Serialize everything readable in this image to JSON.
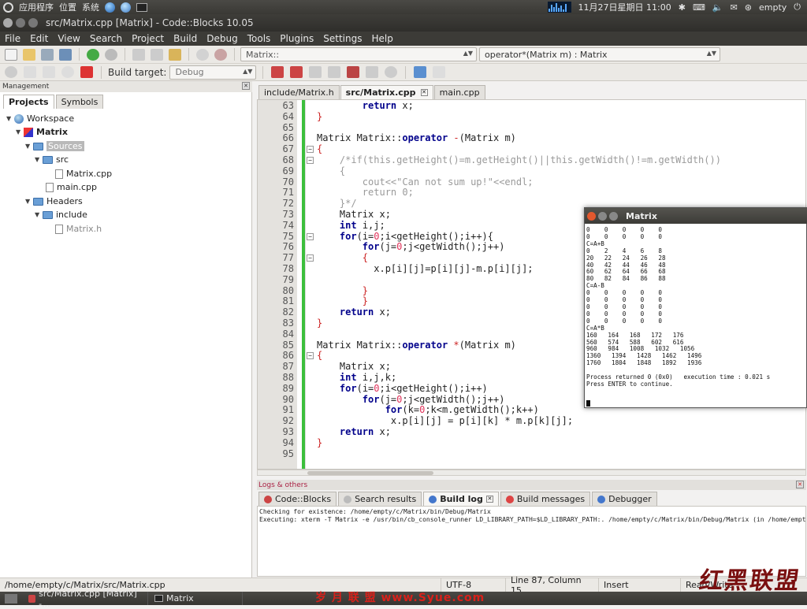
{
  "topbar": {
    "menus": [
      "应用程序",
      "位置",
      "系统"
    ],
    "datetime": "11月27日星期日 11:00",
    "user": "empty"
  },
  "window": {
    "title": "src/Matrix.cpp [Matrix] - Code::Blocks 10.05"
  },
  "menubar": [
    "File",
    "Edit",
    "View",
    "Search",
    "Project",
    "Build",
    "Debug",
    "Tools",
    "Plugins",
    "Settings",
    "Help"
  ],
  "toolbar": {
    "scope_combo": "Matrix::",
    "function_combo": "operator*(Matrix m) : Matrix",
    "build_target_label": "Build target:",
    "build_target_value": "Debug"
  },
  "management": {
    "title": "Management",
    "tabs": [
      "Projects",
      "Symbols"
    ],
    "tree": {
      "workspace": "Workspace",
      "project": "Matrix",
      "sources": "Sources",
      "src": "src",
      "matrix_cpp": "Matrix.cpp",
      "main_cpp": "main.cpp",
      "headers": "Headers",
      "include": "include",
      "matrix_h": "Matrix.h"
    }
  },
  "editor": {
    "tabs": [
      "include/Matrix.h",
      "src/Matrix.cpp",
      "main.cpp"
    ],
    "lines": [
      {
        "n": "63",
        "t": "        return x;"
      },
      {
        "n": "64",
        "t": "}"
      },
      {
        "n": "65",
        "t": ""
      },
      {
        "n": "66",
        "t": "Matrix Matrix::operator -(Matrix m)"
      },
      {
        "n": "67",
        "t": "{"
      },
      {
        "n": "68",
        "t": "    /*if(this.getHeight()=m.getHeight()||this.getWidth()!=m.getWidth())"
      },
      {
        "n": "69",
        "t": "    {"
      },
      {
        "n": "70",
        "t": "        cout<<\"Can not sum up!\"<<endl;"
      },
      {
        "n": "71",
        "t": "        return 0;"
      },
      {
        "n": "72",
        "t": "    }*/"
      },
      {
        "n": "73",
        "t": "    Matrix x;"
      },
      {
        "n": "74",
        "t": "    int i,j;"
      },
      {
        "n": "75",
        "t": "    for(i=0;i<getHeight();i++){"
      },
      {
        "n": "76",
        "t": "        for(j=0;j<getWidth();j++)"
      },
      {
        "n": "77",
        "t": "        {"
      },
      {
        "n": "78",
        "t": "          x.p[i][j]=p[i][j]-m.p[i][j];"
      },
      {
        "n": "79",
        "t": ""
      },
      {
        "n": "80",
        "t": "        }"
      },
      {
        "n": "81",
        "t": "        }"
      },
      {
        "n": "82",
        "t": "    return x;"
      },
      {
        "n": "83",
        "t": "}"
      },
      {
        "n": "84",
        "t": ""
      },
      {
        "n": "85",
        "t": "Matrix Matrix::operator *(Matrix m)"
      },
      {
        "n": "86",
        "t": "{"
      },
      {
        "n": "87",
        "t": "    Matrix x;"
      },
      {
        "n": "88",
        "t": "    int i,j,k;"
      },
      {
        "n": "89",
        "t": "    for(i=0;i<getHeight();i++)"
      },
      {
        "n": "90",
        "t": "        for(j=0;j<getWidth();j++)"
      },
      {
        "n": "91",
        "t": "            for(k=0;k<m.getWidth();k++)"
      },
      {
        "n": "92",
        "t": "             x.p[i][j] = p[i][k] * m.p[k][j];"
      },
      {
        "n": "93",
        "t": "    return x;"
      },
      {
        "n": "94",
        "t": "}"
      },
      {
        "n": "95",
        "t": ""
      }
    ]
  },
  "console": {
    "title": "Matrix",
    "text": "0    0    0    0    0\n0    0    0    0    0\nC=A+B\n0    2    4    6    8\n20   22   24   26   28\n40   42   44   46   48\n60   62   64   66   68\n80   82   84   86   88\nC=A-B\n0    0    0    0    0\n0    0    0    0    0\n0    0    0    0    0\n0    0    0    0    0\n0    0    0    0    0\nC=A*B\n160   164   168   172   176\n560   574   588   602   616\n960   984   1008   1032   1056\n1360   1394   1428   1462   1496\n1760   1804   1848   1892   1936\n\nProcess returned 0 (0x0)   execution time : 0.021 s\nPress ENTER to continue."
  },
  "logs": {
    "title": "Logs & others",
    "tabs": [
      "Code::Blocks",
      "Search results",
      "Build log",
      "Build messages",
      "Debugger"
    ],
    "lines": [
      "Checking for existence: /home/empty/c/Matrix/bin/Debug/Matrix",
      "Executing: xterm -T Matrix -e /usr/bin/cb_console_runner LD_LIBRARY_PATH=$LD_LIBRARY_PATH:. /home/empty/c/Matrix/bin/Debug/Matrix  (in /home/empty/c/Matrix/.)"
    ]
  },
  "statusbar": {
    "path": "/home/empty/c/Matrix/src/Matrix.cpp",
    "encoding": "UTF-8",
    "position": "Line 87, Column 15",
    "mode": "Insert",
    "access": "Read/Write"
  },
  "taskbar": {
    "items": [
      "src/Matrix.cpp [Matrix] -...",
      "Matrix"
    ]
  },
  "watermark": {
    "logo": "红黑联盟",
    "site": "岁 月 联 盟   www.Syue.com"
  }
}
